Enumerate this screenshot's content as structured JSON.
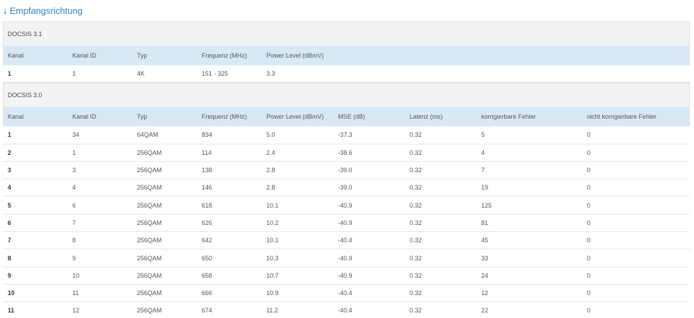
{
  "section": {
    "icon": "arrow-down-icon",
    "icon_glyph": "↓",
    "title": "Empfangsrichtung"
  },
  "docsis31": {
    "label": "DOCSIS 3.1",
    "headers": [
      "Kanal",
      "Kanal ID",
      "Typ",
      "Frequenz (MHz)",
      "Power Level (dBmV)"
    ],
    "rows": [
      [
        "1",
        "1",
        "4K",
        "151 - 325",
        "3.3"
      ]
    ]
  },
  "docsis30": {
    "label": "DOCSIS 3.0",
    "headers": [
      "Kanal",
      "Kanal ID",
      "Typ",
      "Frequenz (MHz)",
      "Power Level (dBmV)",
      "MSE (dB)",
      "Latenz (ms)",
      "korrigierbare Fehler",
      "nicht korrigierbare Fehler"
    ],
    "rows": [
      [
        "1",
        "34",
        "64QAM",
        "834",
        "5.0",
        "-37.3",
        "0.32",
        "5",
        "0"
      ],
      [
        "2",
        "1",
        "256QAM",
        "114",
        "2.4",
        "-38.6",
        "0.32",
        "4",
        "0"
      ],
      [
        "3",
        "3",
        "256QAM",
        "138",
        "2.8",
        "-39.0",
        "0.32",
        "7",
        "0"
      ],
      [
        "4",
        "4",
        "256QAM",
        "146",
        "2.8",
        "-39.0",
        "0.32",
        "19",
        "0"
      ],
      [
        "5",
        "6",
        "256QAM",
        "618",
        "10.1",
        "-40.9",
        "0.32",
        "125",
        "0"
      ],
      [
        "6",
        "7",
        "256QAM",
        "626",
        "10.2",
        "-40.9",
        "0.32",
        "81",
        "0"
      ],
      [
        "7",
        "8",
        "256QAM",
        "642",
        "10.1",
        "-40.4",
        "0.32",
        "45",
        "0"
      ],
      [
        "8",
        "9",
        "256QAM",
        "650",
        "10.3",
        "-40.9",
        "0.32",
        "33",
        "0"
      ],
      [
        "9",
        "10",
        "256QAM",
        "658",
        "10.7",
        "-40.9",
        "0.32",
        "24",
        "0"
      ],
      [
        "10",
        "11",
        "256QAM",
        "666",
        "10.9",
        "-40.4",
        "0.32",
        "12",
        "0"
      ],
      [
        "11",
        "12",
        "256QAM",
        "674",
        "11.2",
        "-40.4",
        "0.32",
        "22",
        "0"
      ]
    ]
  }
}
